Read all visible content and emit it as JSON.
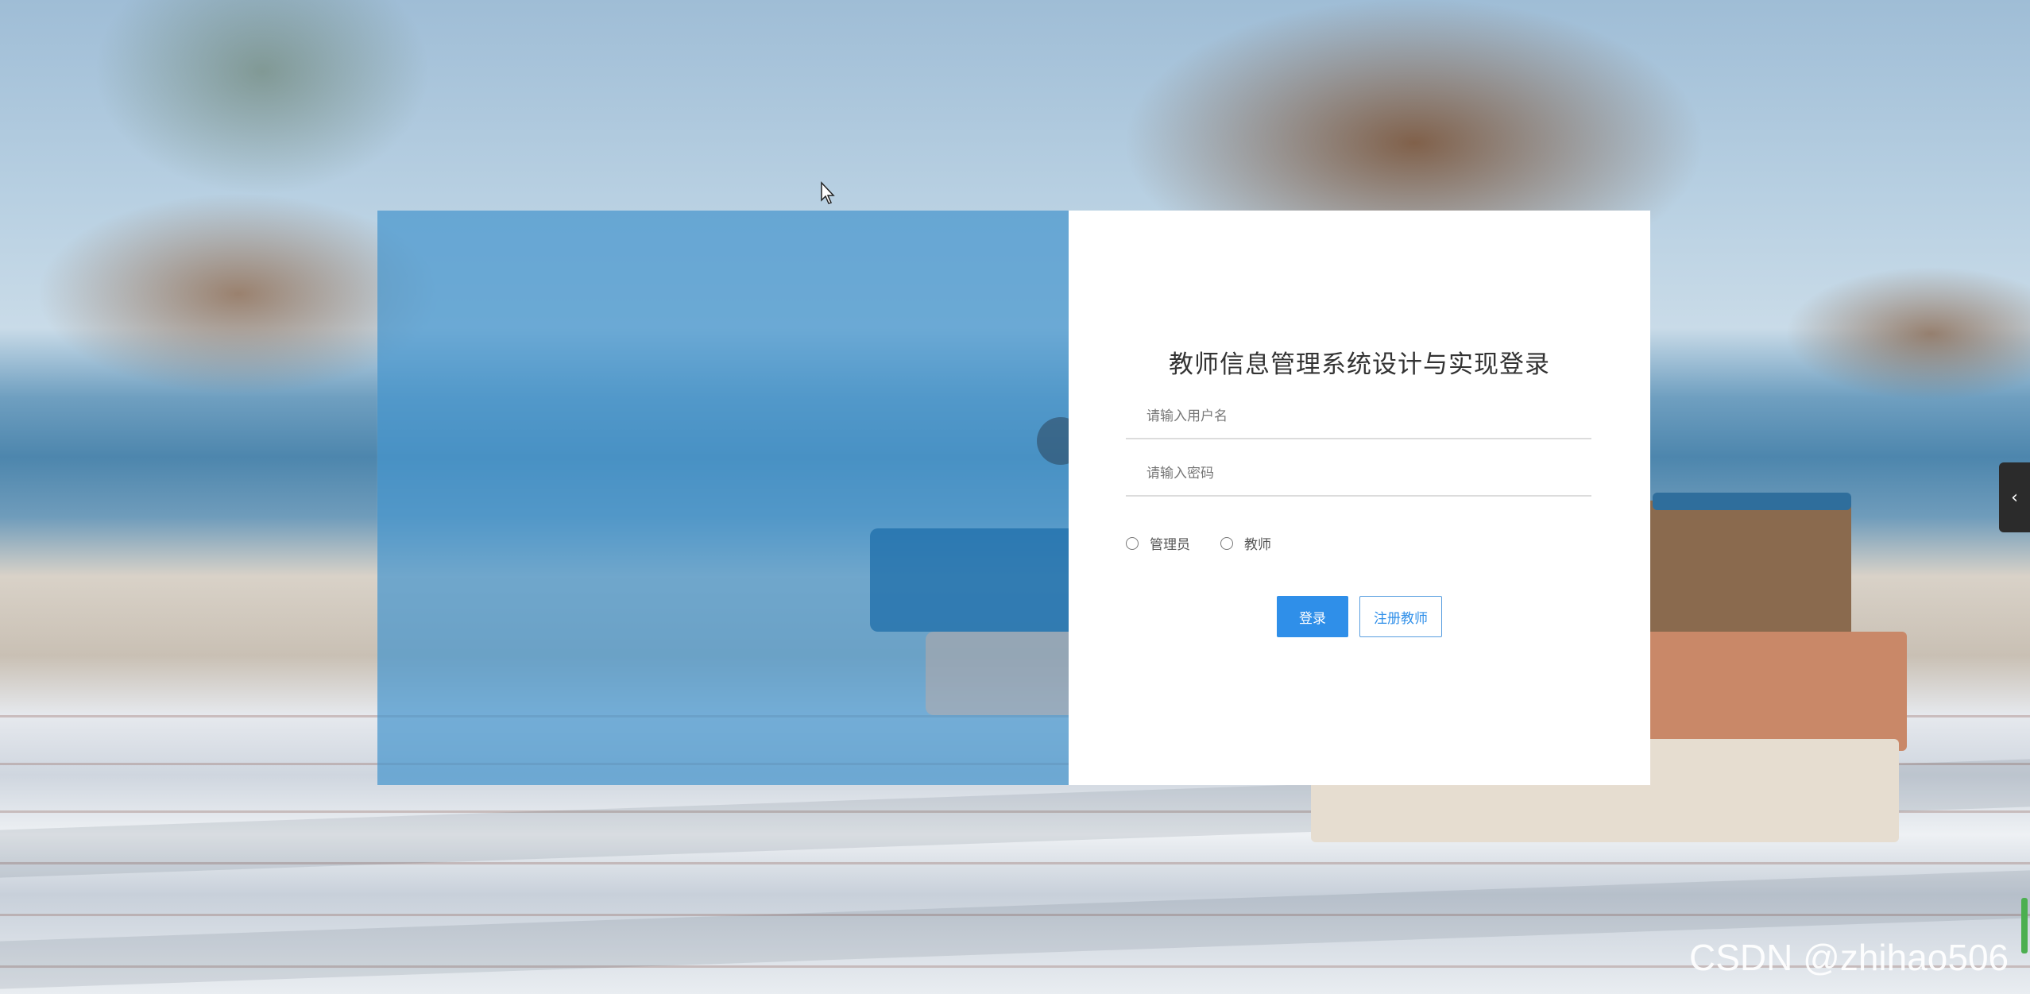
{
  "login": {
    "title": "教师信息管理系统设计与实现登录",
    "username_placeholder": "请输入用户名",
    "password_placeholder": "请输入密码",
    "roles": [
      "管理员",
      "教师"
    ],
    "login_button": "登录",
    "register_button": "注册教师"
  },
  "side_toggle": {
    "icon": "chevron-left-icon",
    "glyph": "‹"
  },
  "watermark": "CSDN @zhihao506",
  "colors": {
    "primary": "#2f8fe9",
    "left_panel_overlay": "#4696cd",
    "card_background": "#ffffff"
  }
}
